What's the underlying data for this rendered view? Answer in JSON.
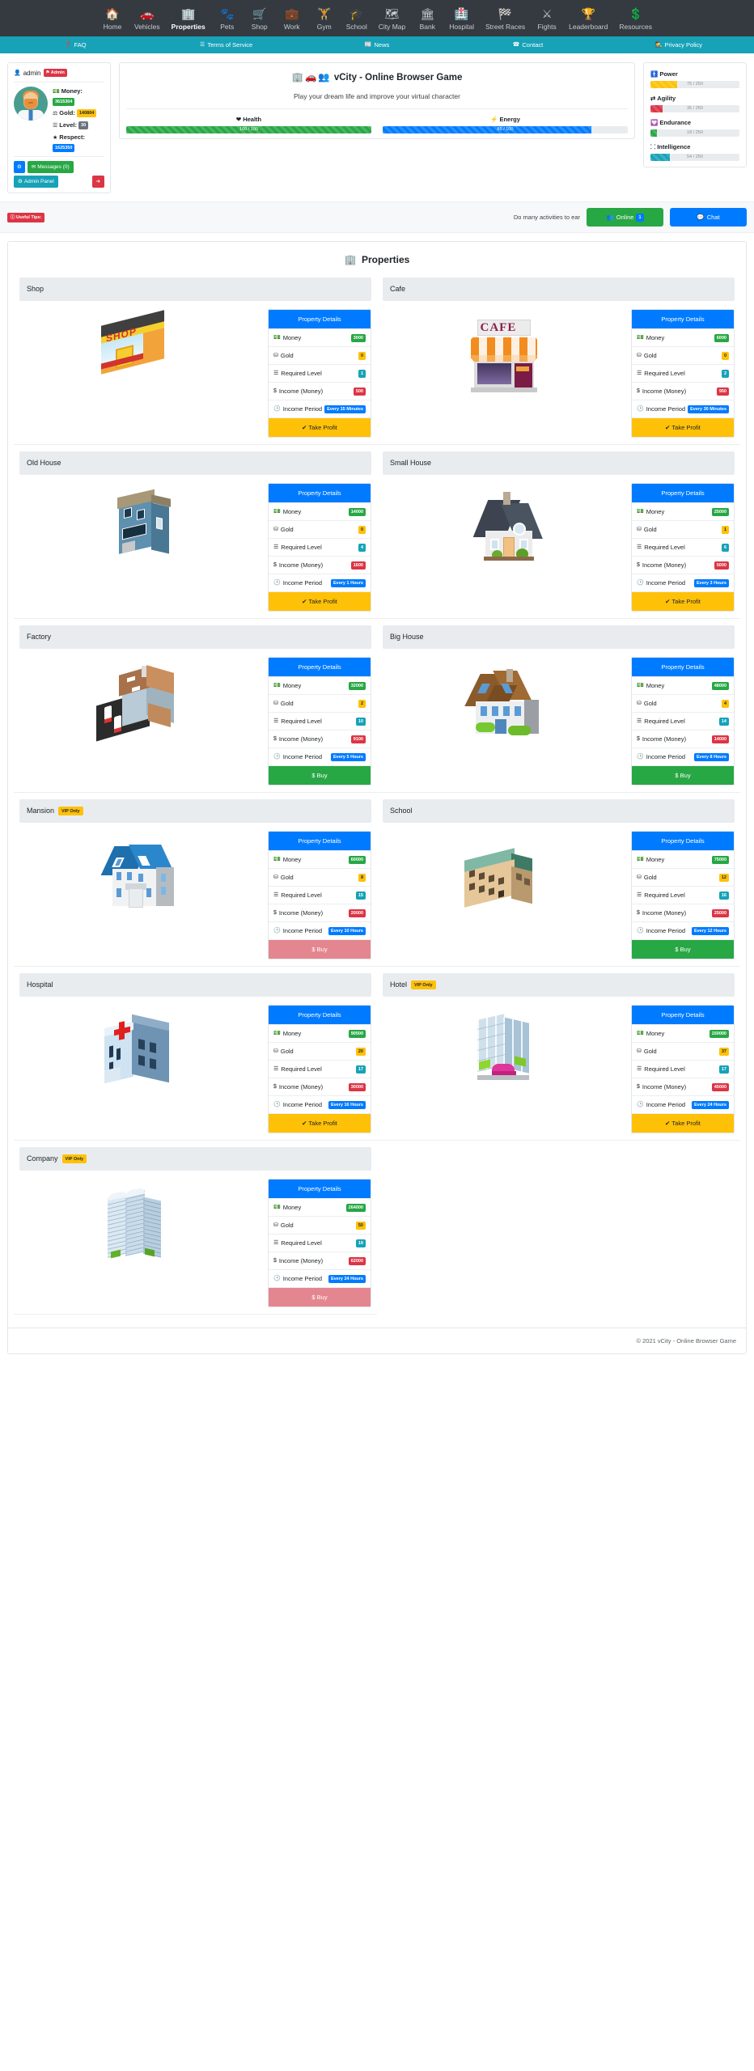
{
  "nav": {
    "items": [
      {
        "label": "Home",
        "icon": "home-icon",
        "glyph": "⌂",
        "active": false
      },
      {
        "label": "Vehicles",
        "icon": "car-icon",
        "glyph": "Ⓒ",
        "active": false
      },
      {
        "label": "Properties",
        "icon": "building-icon",
        "glyph": "▤",
        "active": true
      },
      {
        "label": "Pets",
        "icon": "paw-icon",
        "glyph": "✿",
        "active": false
      },
      {
        "label": "Shop",
        "icon": "cart-icon",
        "glyph": "⛟",
        "active": false
      },
      {
        "label": "Work",
        "icon": "briefcase-icon",
        "glyph": "▬",
        "active": false
      },
      {
        "label": "Gym",
        "icon": "dumbbell-icon",
        "glyph": "‖",
        "active": false
      },
      {
        "label": "School",
        "icon": "graduation-cap-icon",
        "glyph": "▲",
        "active": false
      },
      {
        "label": "City Map",
        "icon": "map-icon",
        "glyph": "▭",
        "active": false
      },
      {
        "label": "Bank",
        "icon": "bank-icon",
        "glyph": "⌂",
        "active": false
      },
      {
        "label": "Hospital",
        "icon": "hospital-icon",
        "glyph": "▥",
        "active": false
      },
      {
        "label": "Street Races",
        "icon": "checkered-flag-icon",
        "glyph": "⚑",
        "active": false
      },
      {
        "label": "Fights",
        "icon": "fist-icon",
        "glyph": "⬢",
        "active": false
      },
      {
        "label": "Leaderboard",
        "icon": "trophy-icon",
        "glyph": "Ἴ6",
        "active": false
      },
      {
        "label": "Resources",
        "icon": "dollar-icon",
        "glyph": "$",
        "active": false
      }
    ]
  },
  "subnav": {
    "items": [
      {
        "label": "FAQ",
        "icon": "question-circle-icon",
        "glyph": "❓"
      },
      {
        "label": "Terms of Service",
        "icon": "list-icon",
        "glyph": "☰"
      },
      {
        "label": "News",
        "icon": "newspaper-icon",
        "glyph": "▤"
      },
      {
        "label": "Contact",
        "icon": "contact-icon",
        "glyph": "☎"
      },
      {
        "label": "Privacy Policy",
        "icon": "user-secret-icon",
        "glyph": "⛉"
      }
    ]
  },
  "profile": {
    "username": "admin",
    "role_badge": "Admin",
    "user_icon": "user-icon",
    "money_label": "Money:",
    "money_value": "3615304",
    "gold_label": "Gold:",
    "gold_value": "140804",
    "level_label": "Level:",
    "level_value": "30",
    "respect_label": "Respect:",
    "respect_value": "1625350",
    "settings_icon": "gear-icon",
    "messages_label": "Messages (0)",
    "messages_icon": "envelope-icon",
    "admin_panel_label": "Admin Panel",
    "admin_panel_icon": "sliders-icon",
    "logout_icon": "logout-icon"
  },
  "hero": {
    "title": "vCity - Online Browser Game",
    "title_icons": [
      "building-icon",
      "car-icon",
      "users-icon"
    ],
    "subtitle": "Play your dream life and improve your virtual character",
    "bars": [
      {
        "label": "Health",
        "icon": "heart-icon",
        "value": 100,
        "max": 100,
        "text": "100 / 100",
        "color": "#28a745"
      },
      {
        "label": "Energy",
        "icon": "bolt-icon",
        "value": 85,
        "max": 100,
        "text": "85 / 100",
        "color": "#007bff"
      }
    ]
  },
  "attributes": [
    {
      "label": "Power",
      "icon": "power-icon",
      "value": 75,
      "max": 250,
      "text": "75 / 250",
      "color": "#ffc107"
    },
    {
      "label": "Agility",
      "icon": "agility-icon",
      "value": 35,
      "max": 250,
      "text": "35 / 250",
      "color": "#dc3545"
    },
    {
      "label": "Endurance",
      "icon": "heartbeat-icon",
      "value": 18,
      "max": 250,
      "text": "18 / 250",
      "color": "#28a745"
    },
    {
      "label": "Intelligence",
      "icon": "brain-icon",
      "value": 54,
      "max": 250,
      "text": "54 / 250",
      "color": "#17a2b8"
    }
  ],
  "tipsbar": {
    "badge": "Useful Tips:",
    "badge_icon": "info-circle-icon",
    "text": "Do many activities to ear",
    "online_label": "Online",
    "online_icon": "users-icon",
    "online_count": "1",
    "chat_label": "Chat",
    "chat_icon": "comment-icon"
  },
  "panel": {
    "title": "Properties",
    "title_icon": "building-icon",
    "details_header": "Property Details",
    "labels": {
      "money": "Money",
      "gold": "Gold",
      "required_level": "Required Level",
      "income_money": "Income (Money)",
      "income_period": "Income Period"
    },
    "icons": {
      "money": "money-bill-icon",
      "gold": "gold-bar-icon",
      "level": "layers-icon",
      "income": "dollar-icon",
      "period": "clock-icon"
    },
    "vip_badge": "VIP Only"
  },
  "properties": [
    {
      "name": "Shop",
      "vip": false,
      "art": "shop",
      "money": "3000",
      "gold": "0",
      "level": "1",
      "income": "500",
      "period": "Every 15 Minutes",
      "action": "Take Profit",
      "action_type": "take-profit",
      "action_icon": "check-icon"
    },
    {
      "name": "Cafe",
      "vip": false,
      "art": "cafe",
      "money": "6000",
      "gold": "0",
      "level": "2",
      "income": "950",
      "period": "Every 30 Minutes",
      "action": "Take Profit",
      "action_type": "take-profit",
      "action_icon": "check-icon"
    },
    {
      "name": "Old House",
      "vip": false,
      "art": "oldhouse",
      "money": "14000",
      "gold": "0",
      "level": "4",
      "income": "1600",
      "period": "Every 1 Hours",
      "action": "Take Profit",
      "action_type": "take-profit",
      "action_icon": "check-icon"
    },
    {
      "name": "Small House",
      "vip": false,
      "art": "smallhouse",
      "money": "25000",
      "gold": "1",
      "level": "6",
      "income": "5000",
      "period": "Every 3 Hours",
      "action": "Take Profit",
      "action_type": "take-profit",
      "action_icon": "check-icon"
    },
    {
      "name": "Factory",
      "vip": false,
      "art": "factory",
      "money": "32000",
      "gold": "2",
      "level": "10",
      "income": "9100",
      "period": "Every 5 Hours",
      "action": "Buy",
      "action_type": "buy",
      "action_icon": "dollar-icon"
    },
    {
      "name": "Big House",
      "vip": false,
      "art": "bighouse",
      "money": "48000",
      "gold": "4",
      "level": "14",
      "income": "14000",
      "period": "Every 8 Hours",
      "action": "Buy",
      "action_type": "buy",
      "action_icon": "dollar-icon"
    },
    {
      "name": "Mansion",
      "vip": true,
      "art": "mansion",
      "money": "60000",
      "gold": "8",
      "level": "15",
      "income": "20000",
      "period": "Every 10 Hours",
      "action": "Buy",
      "action_type": "buy-disabled",
      "action_icon": "dollar-icon"
    },
    {
      "name": "School",
      "vip": false,
      "art": "school",
      "money": "75000",
      "gold": "12",
      "level": "16",
      "income": "25000",
      "period": "Every 12 Hours",
      "action": "Buy",
      "action_type": "buy",
      "action_icon": "dollar-icon"
    },
    {
      "name": "Hospital",
      "vip": false,
      "art": "hospital",
      "money": "90500",
      "gold": "20",
      "level": "17",
      "income": "30000",
      "period": "Every 16 Hours",
      "action": "Take Profit",
      "action_type": "take-profit",
      "action_icon": "check-icon"
    },
    {
      "name": "Hotel",
      "vip": true,
      "art": "hotel",
      "money": "150000",
      "gold": "37",
      "level": "17",
      "income": "45000",
      "period": "Every 24 Hours",
      "action": "Take Profit",
      "action_type": "take-profit",
      "action_icon": "check-icon"
    },
    {
      "name": "Company",
      "vip": true,
      "art": "company",
      "money": "264000",
      "gold": "50",
      "level": "19",
      "income": "62000",
      "period": "Every 24 Hours",
      "action": "Buy",
      "action_type": "buy-disabled",
      "action_icon": "dollar-icon"
    }
  ],
  "footer": {
    "copyright": "© 2021 vCity - Online Browser Game"
  }
}
